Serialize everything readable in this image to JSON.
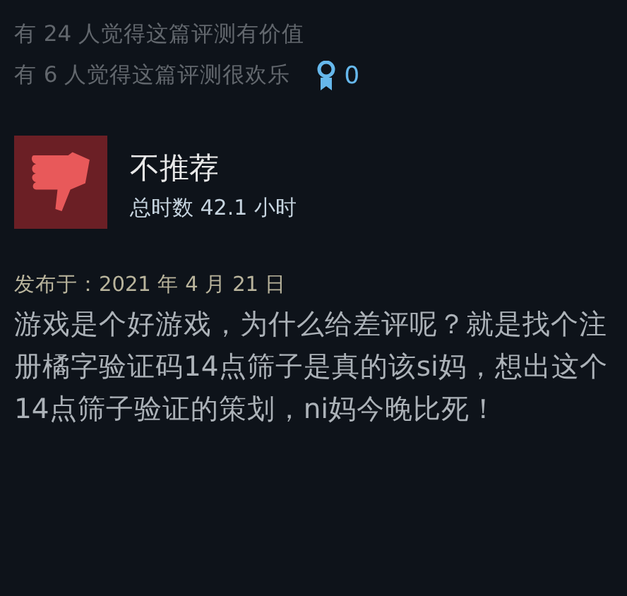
{
  "votes": {
    "helpful": "有 24 人觉得这篇评测有价值",
    "funny": "有 6 人觉得这篇评测很欢乐",
    "awards": "0"
  },
  "review": {
    "recommended": false,
    "verdict": "不推荐",
    "hours": "总时数 42.1 小时",
    "posted": "发布于：2021 年 4 月 21 日",
    "text": "游戏是个好游戏，为什么给差评呢？就是找个注册橘字验证码14点筛子是真的该si妈，想出这个14点筛子验证的策划，ni妈今晚比死！"
  }
}
